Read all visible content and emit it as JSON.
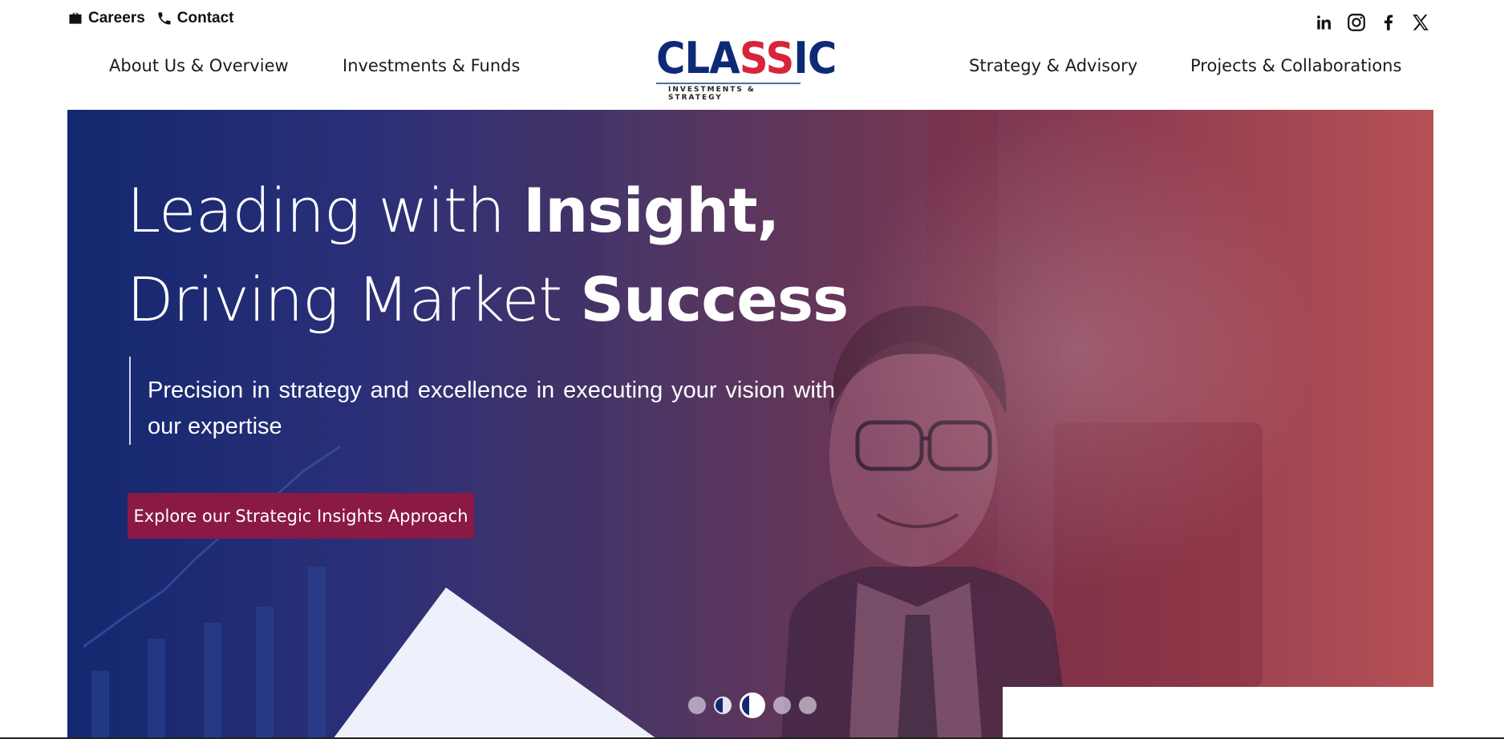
{
  "utility": {
    "careers": "Careers",
    "contact": "Contact"
  },
  "social": [
    "linkedin-icon",
    "instagram-icon",
    "facebook-icon",
    "x-icon"
  ],
  "nav": {
    "about": "About Us & Overview",
    "investments": "Investments & Funds",
    "strategy": "Strategy & Advisory",
    "projects": "Projects & Collaborations"
  },
  "logo": {
    "word_part1": "CLA",
    "word_part2": "SS",
    "word_part3": "IC",
    "tagline": "INVESTMENTS & STRATEGY"
  },
  "hero": {
    "line1_light": "Leading with ",
    "line1_bold": "Insight,",
    "line2_light": "Driving Market ",
    "line2_bold": "Success",
    "subtitle": "Precision in strategy and excellence in executing your vision with our expertise",
    "cta": "Explore our Strategic Insights Approach",
    "slides": 5,
    "active_slide": 3
  },
  "colors": {
    "brand_blue": "#0d2a77",
    "brand_red": "#d6253a",
    "cta": "#8a1a45"
  }
}
